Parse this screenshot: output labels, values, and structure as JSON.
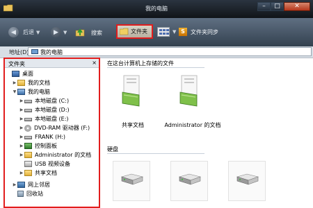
{
  "window": {
    "title": "我的电脑"
  },
  "toolbar": {
    "back_label": "后退",
    "search_label": "搜索",
    "folders_label": "文件夹",
    "sync_label": "文件夹同步"
  },
  "address": {
    "label": "地址(D)",
    "value": "我的电脑"
  },
  "folders_pane": {
    "title": "文件夹",
    "close": "×",
    "items": [
      {
        "label": "桌面"
      },
      {
        "label": "我的文档"
      },
      {
        "label": "我的电脑"
      },
      {
        "label": "本地磁盘 (C:)"
      },
      {
        "label": "本地磁盘 (D:)"
      },
      {
        "label": "本地磁盘 (E:)"
      },
      {
        "label": "DVD-RAM 驱动器 (F:)"
      },
      {
        "label": "FRANK (H:)"
      },
      {
        "label": "控制面板"
      },
      {
        "label": "Administrator 的文档"
      },
      {
        "label": "USB 视频设备"
      },
      {
        "label": "共享文档"
      },
      {
        "label": "网上邻居"
      },
      {
        "label": "回收站"
      }
    ]
  },
  "content": {
    "stored_files_title": "在这台计算机上存储的文件",
    "stored_items": [
      {
        "label": "共享文档"
      },
      {
        "label": "Administrator 的文档"
      }
    ],
    "drives_title": "硬盘"
  }
}
